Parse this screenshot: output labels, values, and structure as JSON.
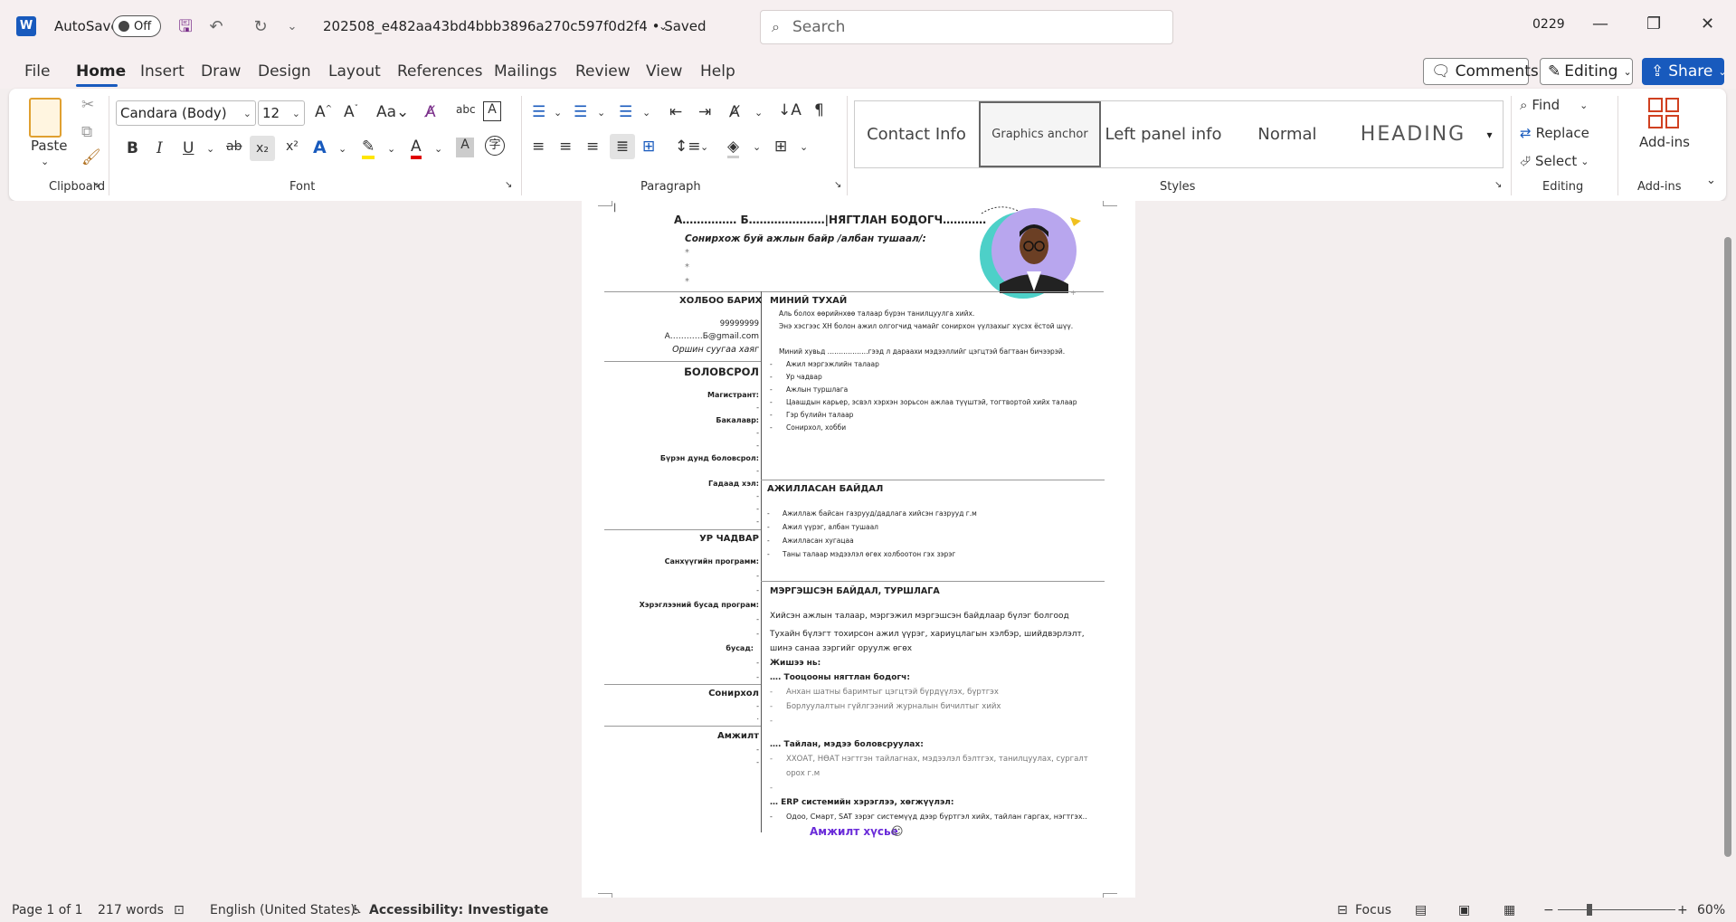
{
  "app": {
    "logo": "W",
    "autosave_label": "AutoSave",
    "autosave_state": "Off",
    "doc_title": "202508_e482aa43bd4bbb3896a270c597f0d2f4 • Saved",
    "search_placeholder": "Search",
    "user_id": "0229"
  },
  "menu": {
    "tabs": [
      "File",
      "Home",
      "Insert",
      "Draw",
      "Design",
      "Layout",
      "References",
      "Mailings",
      "Review",
      "View",
      "Help"
    ],
    "comments_label": "Comments",
    "editing_label": "Editing",
    "share_label": "Share"
  },
  "ribbon": {
    "clipboard": {
      "paste_label": "Paste",
      "group_label": "Clipboard"
    },
    "font": {
      "font_name": "Candara (Body)",
      "font_size": "12",
      "group_label": "Font"
    },
    "paragraph": {
      "group_label": "Paragraph"
    },
    "styles": {
      "items": [
        "Contact Info",
        "Graphics anchor",
        "Left panel info",
        "Normal",
        "HEADING"
      ],
      "group_label": "Styles"
    },
    "editing": {
      "find_label": "Find",
      "replace_label": "Replace",
      "select_label": "Select",
      "group_label": "Editing"
    },
    "addins": {
      "label": "Add-ins",
      "group_label": "Add-ins"
    }
  },
  "document": {
    "name_line": "А…………… Б…………………|НЯГТЛАН БОДОГЧ…………",
    "position_heading": "Сонирхож буй ажлын байр /албан тушаал/:",
    "bullet_star": "*",
    "contact_heading": "ХОЛБОО БАРИХ",
    "phone": "99999999",
    "email": "А…………Б@gmail.com",
    "address": "Оршин суугаа хаяг",
    "about_heading": "МИНИЙ ТУХАЙ",
    "about_lines": [
      "Аль болох өөрийнхөө талаар бүрэн танилцуулга хийх.",
      "Энэ хэсгээс ХН болон ажил олгогчид чамайг сонирхон үүлзахыг хүсэх ёстой шүү.",
      "Миний хувьд  ………………гээд л дараахи мэдээллийг цэгцтэй багтаан бичээрэй."
    ],
    "about_bullets": [
      "Ажил мэргэжлийн талаар",
      "Ур чадвар",
      "Ажлын туршлага",
      "Цаашдын карьер, эсвэл хэрхэн зорьсон ажлаа түүштэй, тогтвортой хийх талаар",
      "Гэр бүлийн талаар",
      "Сонирхол, хобби"
    ],
    "education_heading": "БОЛОВСРОЛ",
    "education_items": [
      "Магистрант:",
      "Бакалавр:",
      "Бүрэн дунд боловсрол:",
      "Гадаад хэл:"
    ],
    "experience_heading": "АЖИЛЛАСАН БАЙДАЛ",
    "experience_bullets": [
      "Ажиллаж байсан газрууд/дадлага хийсэн газрууд г.м",
      "Ажил үүрэг, албан тушаал",
      "Ажилласан хугацаа",
      "Таны талаар мэдээлэл өгөх холбоотон гэх зэрэг"
    ],
    "skills_heading": "УР ЧАДВАР",
    "skills_items": [
      "Санхүүгийн программ:",
      "Хэрэглээний бусад програм:",
      "бусад:"
    ],
    "hobby_heading": "Сонирхол",
    "success_left_heading": "Амжилт",
    "expertise_heading": "МЭРГЭШСЭН БАЙДАЛ, ТУРШЛАГА",
    "expertise_lines": [
      "Хийсэн ажлын талаар, мэргэжил мэргэшсэн байдлаар бүлэг болгоод",
      "Тухайн бүлэгт тохирсон ажил үүрэг, хариуцлагын хэлбэр, шийдвэрлэлт,",
      "шинэ санаа зэргийг оруулж өгөх"
    ],
    "example_label": "Жишээ нь:",
    "sub1_heading": "…. Тооцооны нягтлан бодогч:",
    "sub1_bullets": [
      "Анхан шатны баримтыг цэгцтэй бүрдүүлэх, бүртгэх",
      "Борлуулалтын гүйлгээний журналын бичилтыг хийх"
    ],
    "sub2_heading": "…. Тайлан, мэдээ боловсруулах:",
    "sub2_bullets": [
      "ХХОАТ, НӨАТ нэгтгэн тайлагнах, мэдээлэл бэлтгэх, танилцуулах, сургалт",
      "орох г.м"
    ],
    "sub3_heading": "… ERP системийн хэрэглээ, хөгжүүлэл:",
    "sub3_bullets": [
      "Одоо, Смарт, SAT зэрэг системүүд дээр бүртгэл хийх, тайлан гаргах, нэгтгэх.."
    ],
    "closing": "Амжилт хүсье",
    "dash": "-",
    "dot": "."
  },
  "status": {
    "page": "Page 1 of 1",
    "words": "217 words",
    "language": "English (United States)",
    "accessibility": "Accessibility: Investigate",
    "focus": "Focus",
    "zoom": "60%"
  },
  "colors": {
    "accent": "#185abd",
    "closing": "#6a2bd9"
  }
}
